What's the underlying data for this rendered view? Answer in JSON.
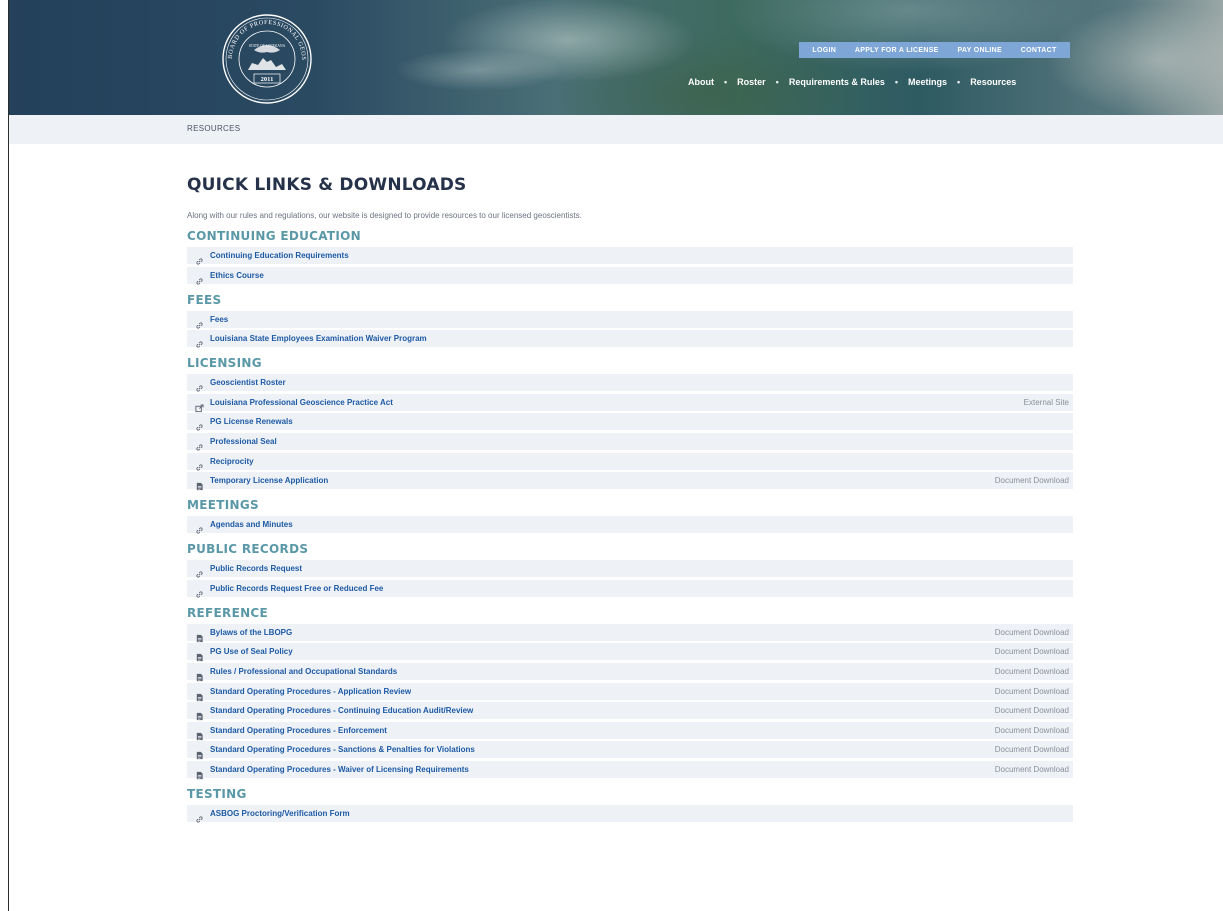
{
  "header": {
    "logo": {
      "ring_text": "BOARD OF PROFESSIONAL GEOSCIENTISTS",
      "inner_text": "STATE OF LOUISIANA",
      "year": "2011"
    },
    "utility_nav": [
      "LOGIN",
      "APPLY FOR A LICENSE",
      "PAY ONLINE",
      "CONTACT"
    ],
    "main_nav": [
      "About",
      "Roster",
      "Requirements & Rules",
      "Meetings",
      "Resources"
    ]
  },
  "breadcrumb": "RESOURCES",
  "page": {
    "title": "QUICK LINKS & DOWNLOADS",
    "intro": "Along with our rules and regulations, our website is designed to provide resources to our licensed geoscientists."
  },
  "sections": [
    {
      "heading": "CONTINUING EDUCATION",
      "items": [
        {
          "label": "Continuing Education Requirements",
          "icon": "link-icon",
          "note": ""
        },
        {
          "label": "Ethics Course",
          "icon": "link-icon",
          "note": ""
        }
      ]
    },
    {
      "heading": "FEES",
      "items": [
        {
          "label": "Fees",
          "icon": "link-icon",
          "note": ""
        },
        {
          "label": "Louisiana State Employees Examination Waiver Program",
          "icon": "link-icon",
          "note": ""
        }
      ]
    },
    {
      "heading": "LICENSING",
      "items": [
        {
          "label": "Geoscientist Roster",
          "icon": "link-icon",
          "note": ""
        },
        {
          "label": "Louisiana Professional Geoscience Practice Act",
          "icon": "external-link-icon",
          "note": "External Site"
        },
        {
          "label": "PG License Renewals",
          "icon": "link-icon",
          "note": ""
        },
        {
          "label": "Professional Seal",
          "icon": "link-icon",
          "note": ""
        },
        {
          "label": "Reciprocity",
          "icon": "link-icon",
          "note": ""
        },
        {
          "label": "Temporary License Application",
          "icon": "document-icon",
          "note": "Document Download"
        }
      ]
    },
    {
      "heading": "MEETINGS",
      "items": [
        {
          "label": "Agendas and Minutes",
          "icon": "link-icon",
          "note": ""
        }
      ]
    },
    {
      "heading": "PUBLIC RECORDS",
      "items": [
        {
          "label": "Public Records Request",
          "icon": "link-icon",
          "note": ""
        },
        {
          "label": "Public Records Request Free or Reduced Fee",
          "icon": "link-icon",
          "note": ""
        }
      ]
    },
    {
      "heading": "REFERENCE",
      "items": [
        {
          "label": "Bylaws of the LBOPG",
          "icon": "document-icon",
          "note": "Document Download"
        },
        {
          "label": "PG Use of Seal Policy",
          "icon": "document-icon",
          "note": "Document Download"
        },
        {
          "label": "Rules / Professional and Occupational Standards",
          "icon": "document-icon",
          "note": "Document Download"
        },
        {
          "label": "Standard Operating Procedures - Application Review",
          "icon": "document-icon",
          "note": "Document Download"
        },
        {
          "label": "Standard Operating Procedures - Continuing Education Audit/Review",
          "icon": "document-icon",
          "note": "Document Download"
        },
        {
          "label": "Standard Operating Procedures - Enforcement",
          "icon": "document-icon",
          "note": "Document Download"
        },
        {
          "label": "Standard Operating Procedures - Sanctions & Penalties for Violations",
          "icon": "document-icon",
          "note": "Document Download"
        },
        {
          "label": "Standard Operating Procedures - Waiver of Licensing Requirements",
          "icon": "document-icon",
          "note": "Document Download"
        }
      ]
    },
    {
      "heading": "TESTING",
      "items": [
        {
          "label": "ASBOG Proctoring/Verification Form",
          "icon": "link-icon",
          "note": ""
        }
      ]
    }
  ],
  "colors": {
    "link": "#1d5aa6",
    "section_heading": "#5a98a8",
    "row_background": "#eef1f5",
    "utility_nav": "#7ea6d6",
    "title": "#253249"
  }
}
